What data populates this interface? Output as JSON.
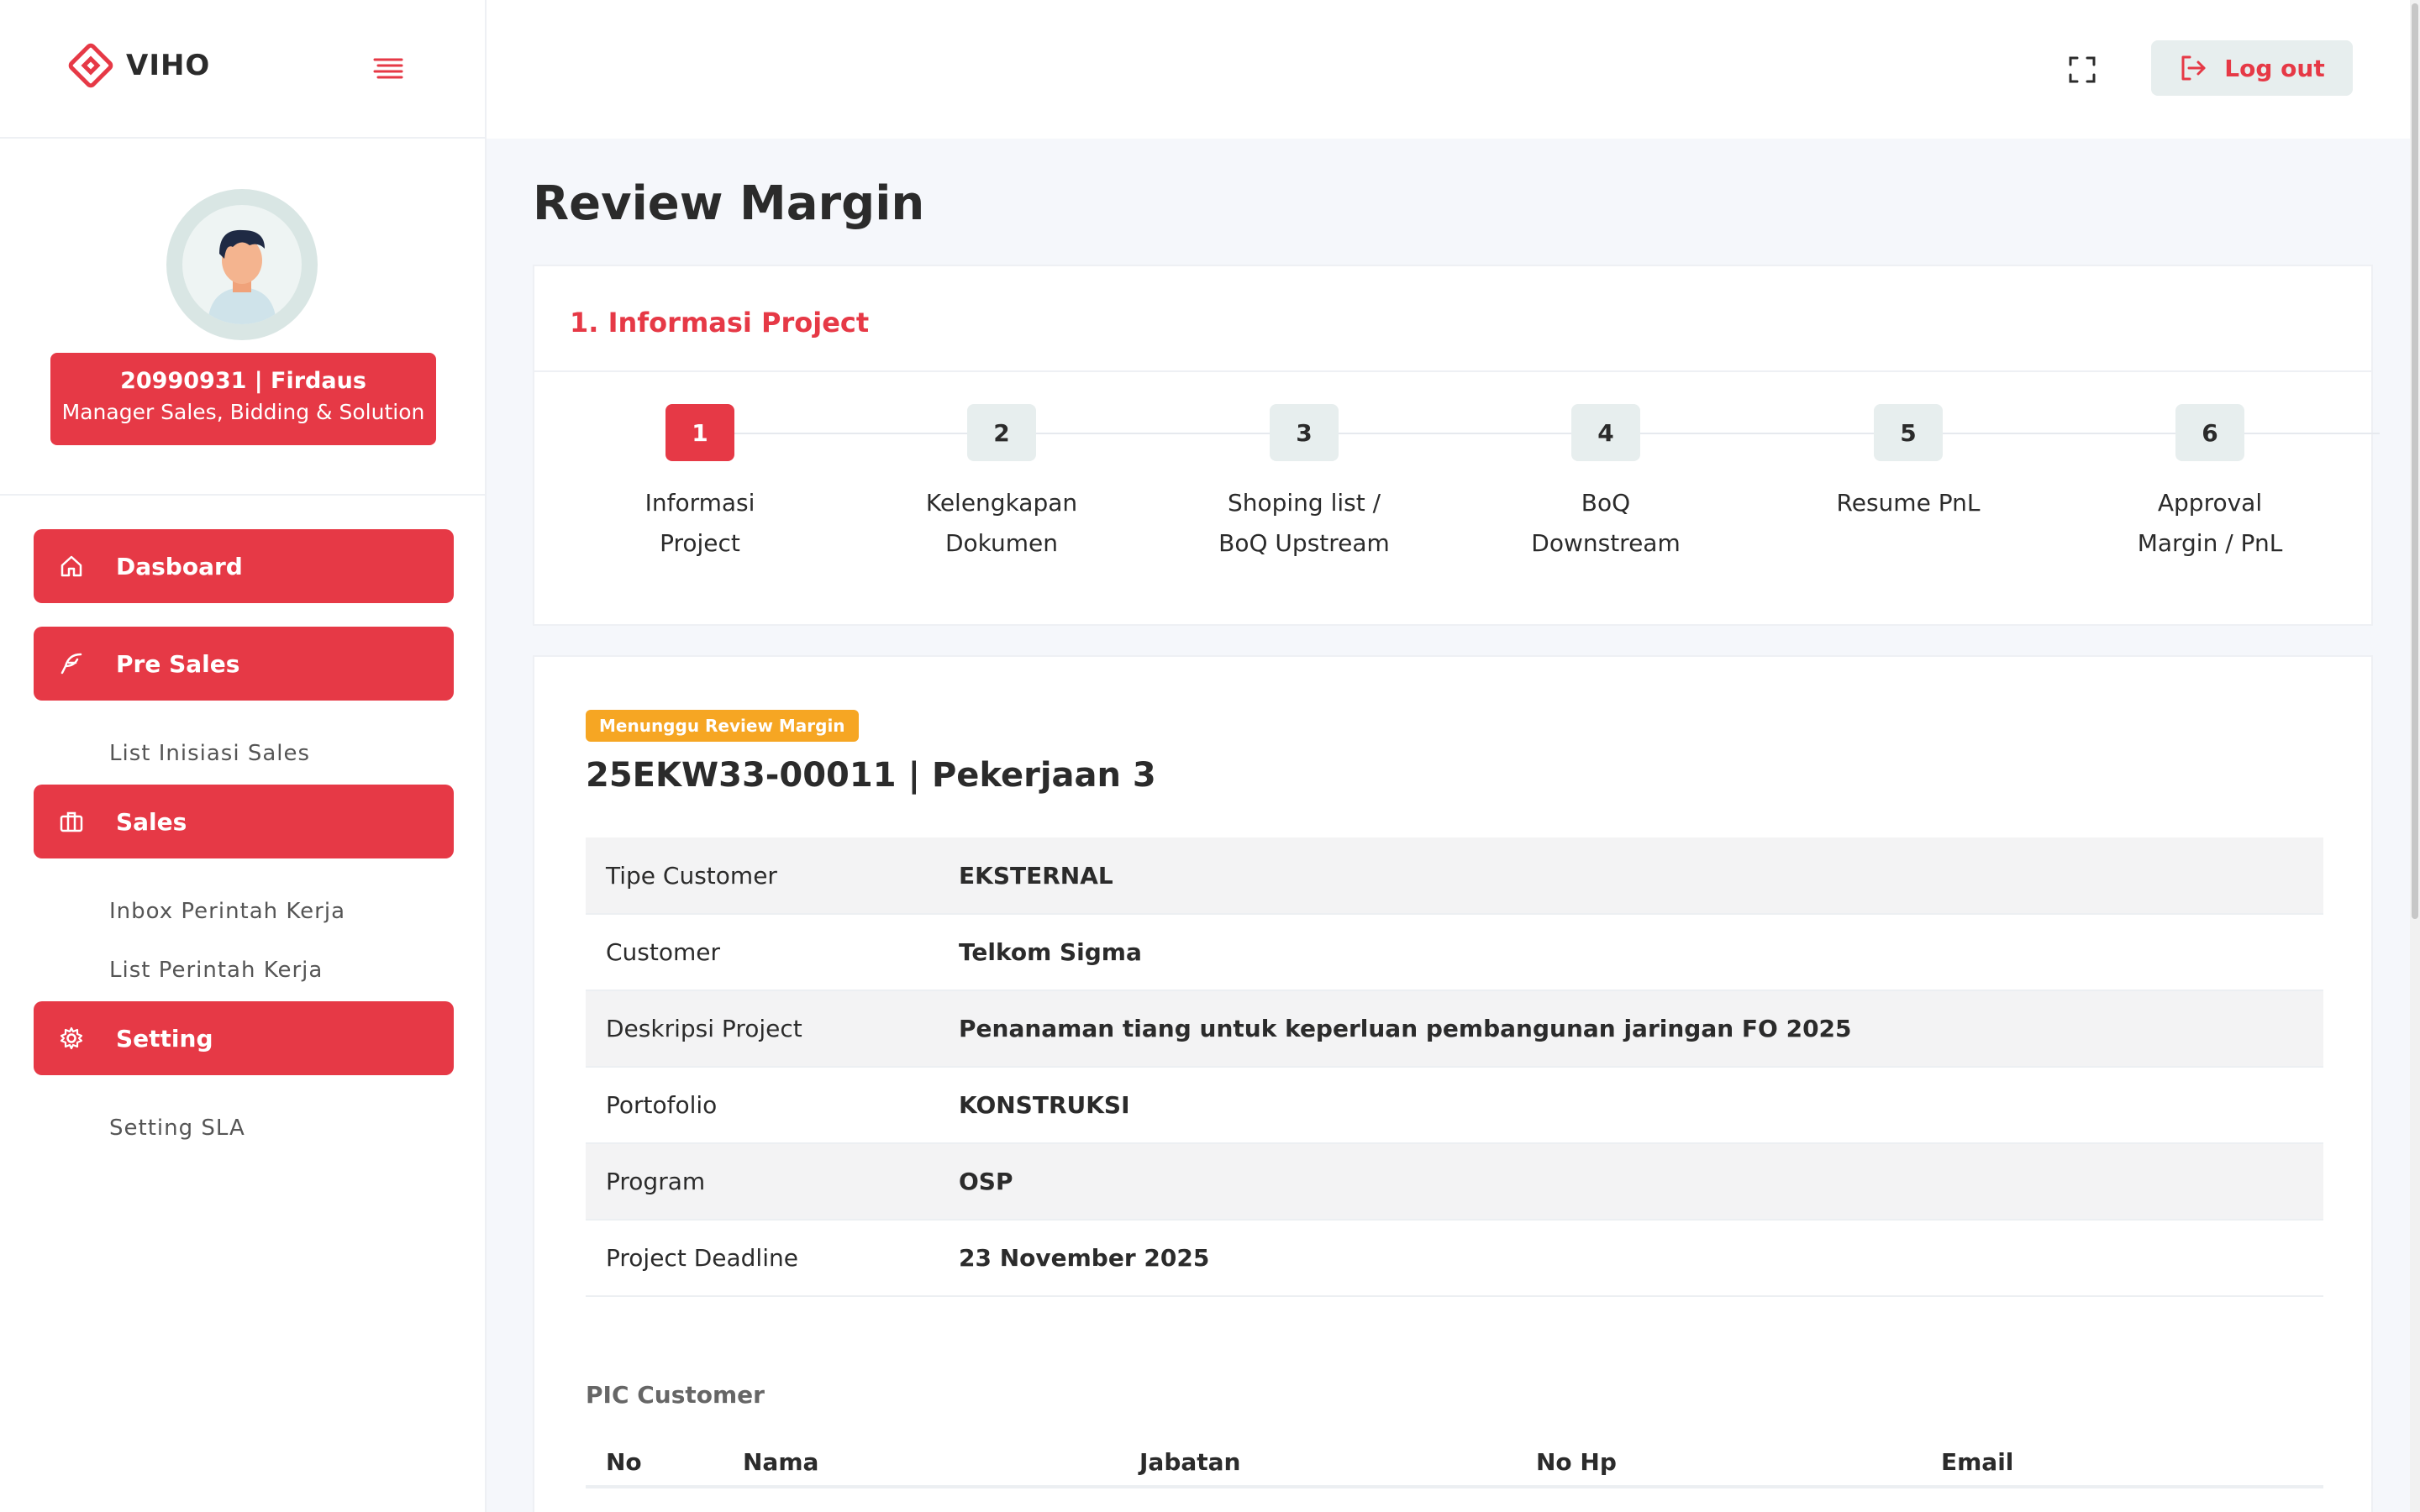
{
  "app": {
    "name": "VIHO"
  },
  "profile": {
    "id_name": "20990931 | Firdaus",
    "role": "Manager Sales, Bidding & Solution"
  },
  "nav": {
    "dashboard": "Dasboard",
    "presales": "Pre Sales",
    "presales_items": [
      "List Inisiasi Sales"
    ],
    "sales": "Sales",
    "sales_items": [
      "Inbox Perintah Kerja",
      "List Perintah Kerja"
    ],
    "setting": "Setting",
    "setting_items": [
      "Setting SLA"
    ]
  },
  "header": {
    "logout": "Log out"
  },
  "page": {
    "title": "Review Margin"
  },
  "section1": {
    "title": "1. Informasi Project"
  },
  "steps": [
    {
      "num": "1",
      "label": "Informasi Project",
      "active": true
    },
    {
      "num": "2",
      "label": "Kelengkapan Dokumen",
      "active": false
    },
    {
      "num": "3",
      "label": "Shoping list / BoQ Upstream",
      "active": false
    },
    {
      "num": "4",
      "label": "BoQ Downstream",
      "active": false
    },
    {
      "num": "5",
      "label": "Resume PnL",
      "active": false
    },
    {
      "num": "6",
      "label": "Approval Margin / PnL",
      "active": false
    }
  ],
  "project": {
    "status": "Menunggu Review Margin",
    "title": "25EKW33-00011 | Pekerjaan 3",
    "fields": [
      {
        "key": "Tipe Customer",
        "value": "EKSTERNAL"
      },
      {
        "key": "Customer",
        "value": "Telkom Sigma"
      },
      {
        "key": "Deskripsi Project",
        "value": "Penanaman tiang untuk keperluan pembangunan jaringan FO 2025"
      },
      {
        "key": "Portofolio",
        "value": "KONSTRUKSI"
      },
      {
        "key": "Program",
        "value": "OSP"
      },
      {
        "key": "Project Deadline",
        "value": "23 November 2025"
      }
    ]
  },
  "pic": {
    "title": "PIC Customer",
    "columns": [
      "No",
      "Nama",
      "Jabatan",
      "No Hp",
      "Email"
    ]
  },
  "colors": {
    "accent": "#e63946",
    "badge": "#f6a623",
    "muted_btn": "#e7eeee"
  }
}
